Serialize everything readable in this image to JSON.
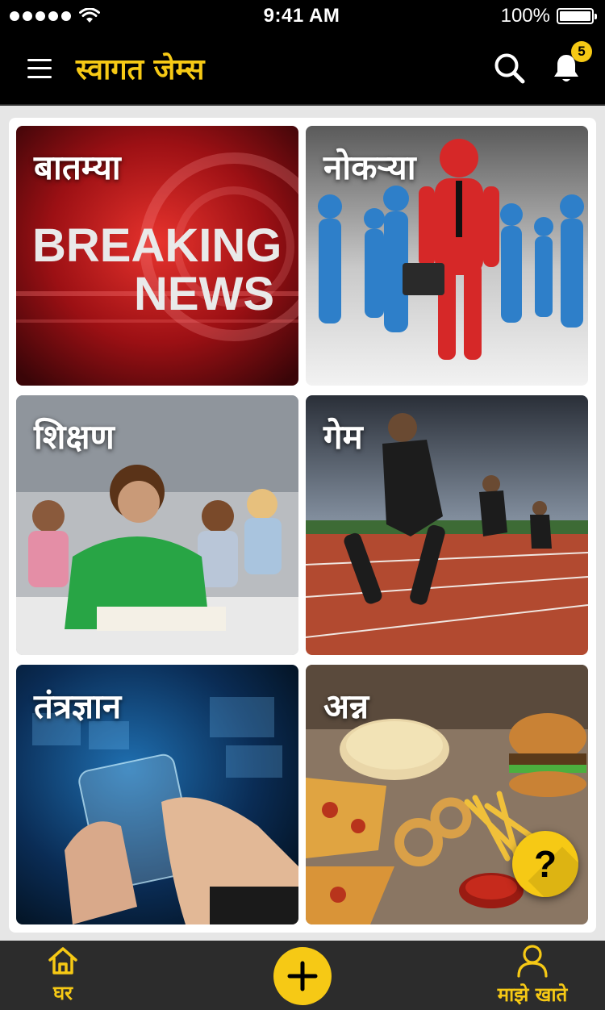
{
  "status_bar": {
    "time": "9:41 AM",
    "battery_text": "100%",
    "wifi_icon": "wifi-icon",
    "signal_icon": "cellular-signal-icon",
    "battery_icon": "battery-full-icon"
  },
  "header": {
    "title": "स्वागत जेम्स",
    "menu_icon": "hamburger-menu-icon",
    "search_icon": "search-icon",
    "notification_icon": "bell-icon",
    "notification_count": "5"
  },
  "tiles": [
    {
      "label": "बातम्या",
      "image_alt": "Breaking news graphic",
      "image_text_1": "BREAKING",
      "image_text_2": "NEWS"
    },
    {
      "label": "नोकऱ्या",
      "image_alt": "Red business figure with briefcase among blue figures"
    },
    {
      "label": "शिक्षण",
      "image_alt": "Students studying in classroom"
    },
    {
      "label": "गेम",
      "image_alt": "Sprinters running on track"
    },
    {
      "label": "तंत्रज्ञान",
      "image_alt": "Hand touching transparent device"
    },
    {
      "label": "अन्न",
      "image_alt": "Fast food: pizza, fries, burger, onion rings"
    }
  ],
  "help_button": {
    "label": "?",
    "icon": "help-question-icon"
  },
  "bottom_nav": {
    "home_label": "घर",
    "home_icon": "home-icon",
    "add_icon": "plus-icon",
    "account_label": "माझे खाते",
    "account_icon": "user-icon"
  },
  "colors": {
    "accent": "#f6c915",
    "header_bg": "#000000",
    "bottom_nav_bg": "#2c2c2c",
    "page_bg": "#e6e6e6"
  }
}
